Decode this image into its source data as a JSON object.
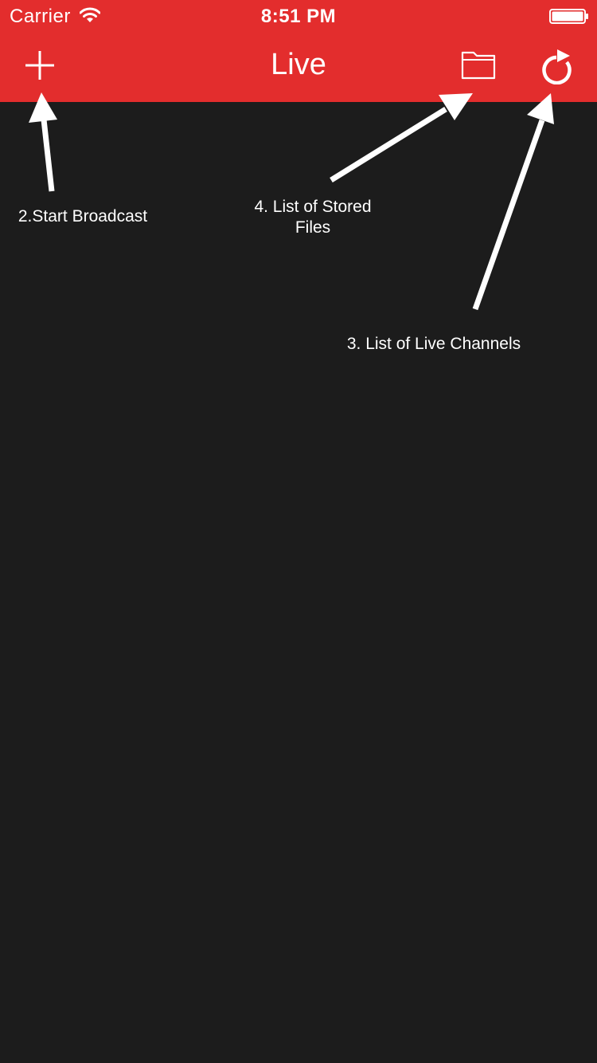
{
  "status_bar": {
    "carrier": "Carrier",
    "time": "8:51 PM",
    "wifi_icon": "wifi-icon",
    "battery_icon": "battery-icon"
  },
  "nav_bar": {
    "title": "Live",
    "add_icon": "plus-icon",
    "folder_icon": "folder-icon",
    "refresh_icon": "refresh-icon"
  },
  "annotations": {
    "start_broadcast": "2.Start Broadcast",
    "stored_files": "4. List of Stored Files",
    "live_channels": "3. List of Live Channels"
  },
  "colors": {
    "accent": "#e32d2d",
    "background": "#1c1c1c",
    "foreground": "#ffffff"
  }
}
